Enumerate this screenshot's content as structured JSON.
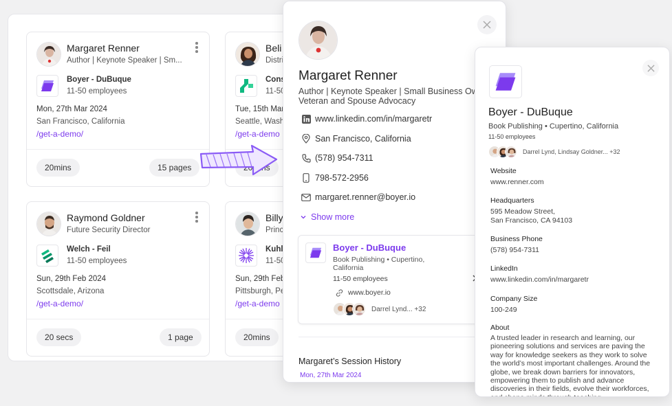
{
  "colors": {
    "accent": "#7c3aed",
    "background": "#f1f1f2"
  },
  "cards": [
    {
      "name": "Margaret Renner",
      "title": "Author | Keynote Speaker | Sm...",
      "company": "Boyer - DuBuque",
      "company_size": "11-50 employees",
      "date": "Mon, 27th Mar 2024",
      "location": "San Francisco, California",
      "link": "/get-a-demo/",
      "duration": "20mins",
      "pages": "15 pages",
      "logo": "boyer-logo"
    },
    {
      "name": "Beli",
      "title": "Distri",
      "company": "Cons",
      "company_size": "11-50",
      "date": "Tue, 15th Mar",
      "location": "Seattle, Wash",
      "link": "/get-a-demo",
      "duration": "20mins",
      "pages": "",
      "logo": "green-cross-logo"
    },
    {
      "name": "Raymond Goldner",
      "title": "Future Security Director",
      "company": "Welch - Feil",
      "company_size": "11-50 employees",
      "date": "Sun, 29th Feb 2024",
      "location": "Scottsdale, Arizona",
      "link": "/get-a-demo/",
      "duration": "20 secs",
      "pages": "1 page",
      "logo": "welch-logo"
    },
    {
      "name": "Billy",
      "title": "Princ",
      "company": "Kuhl",
      "company_size": "11-50",
      "date": "Sun, 29th Feb",
      "location": "Pittsburgh, Pen",
      "link": "/get-a-demo",
      "duration": "20mins",
      "pages": "",
      "logo": "starburst-logo"
    }
  ],
  "profile": {
    "name": "Margaret Renner",
    "title": "Author | Keynote Speaker | Small Business Ow | Veteran and Spouse Advocacy",
    "linkedin": "www.linkedin.com/in/margaretr",
    "location": "San Francisco, California",
    "phone": "(578) 954-7311",
    "mobile": "798-572-2956",
    "email": "margaret.renner@boyer.io",
    "show_more": "Show more",
    "company": {
      "name": "Boyer - DuBuque",
      "industry": "Book Publishing • Cupertino, California",
      "size": "11-50 employees",
      "website": "www.boyer.io",
      "people": "Darrel Lynd... +32"
    },
    "history_title": "Margaret’s Session History",
    "history_date": "Mon, 27th Mar 2024"
  },
  "company": {
    "name": "Boyer - DuBuque",
    "industry": "Book Publishing • Cupertino, California",
    "employees": "11-50 employees",
    "people": "Darrel Lynd, Lindsay Goldner... +32",
    "website_label": "Website",
    "website": "www.renner.com",
    "hq_label": "Headquarters",
    "hq_line1": "595 Meadow Street,",
    "hq_line2": "San Francisco, CA 94103",
    "phone_label": "Business Phone",
    "phone": "(578) 954-7311",
    "linkedin_label": "LinkedIn",
    "linkedin": "www.linkedin.com/in/margaretr",
    "size_label": "Company Size",
    "size": "100-249",
    "about_label": "About",
    "about": "A trusted leader in research and learning, our pioneering solutions and services are paving the way for knowledge seekers as they work to solve the world’s most important challenges. Around the globe, we break down barriers for innovators, empowering them to publish and advance discoveries in their fields, evolve their workforces, and shape minds through teaching"
  }
}
